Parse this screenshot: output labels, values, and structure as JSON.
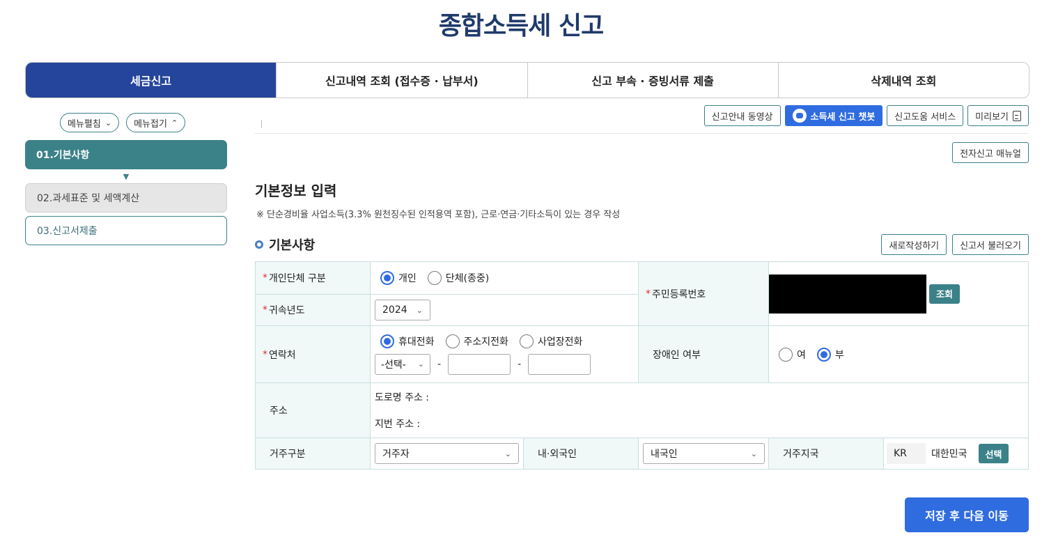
{
  "page": {
    "title": "종합소득세 신고"
  },
  "tabs": [
    "세금신고",
    "신고내역 조회 (접수증 · 납부서)",
    "신고 부속 · 증빙서류 제출",
    "삭제내역 조회"
  ],
  "menu": {
    "expand": "메뉴펼침",
    "collapse": "메뉴접기"
  },
  "steps": [
    "01.기본사항",
    "02.과세표준 및 세액계산",
    "03.신고서제출"
  ],
  "toolbar": {
    "video": "신고안내 동영상",
    "chatbot": "소득세 신고 챗봇",
    "help": "신고도움 서비스",
    "preview": "미리보기"
  },
  "manual": "전자신고 매뉴얼",
  "section": {
    "title": "기본정보 입력",
    "note": "※ 단순경비율 사업소득(3.3% 원천징수된 인적용역 포함), 근로·연금·기타소득이 있는 경우 작성"
  },
  "sub": {
    "title": "기본사항",
    "new": "새로작성하기",
    "load": "신고서 불러오기"
  },
  "form": {
    "type_label": "개인단체 구분",
    "type_opts": [
      "개인",
      "단체(종중)"
    ],
    "year_label": "귀속년도",
    "year_value": "2024",
    "rrn_label": "주민등록번호",
    "lookup": "조회",
    "contact_label": "연락처",
    "contact_opts": [
      "휴대전화",
      "주소지전화",
      "사업장전화"
    ],
    "contact_select": "-선택-",
    "dash": "-",
    "disabled_label": "장애인 여부",
    "disabled_opts": [
      "여",
      "부"
    ],
    "address_label": "주소",
    "road_addr": "도로명 주소 :",
    "lot_addr": "지번 주소 :",
    "residence_label": "거주구분",
    "residence_value": "거주자",
    "nationality_label": "내·외국인",
    "nationality_value": "내국인",
    "country_label": "거주지국",
    "country_code": "KR",
    "country_name": "대한민국",
    "select_btn": "선택"
  },
  "save": "저장 후 다음 이동"
}
